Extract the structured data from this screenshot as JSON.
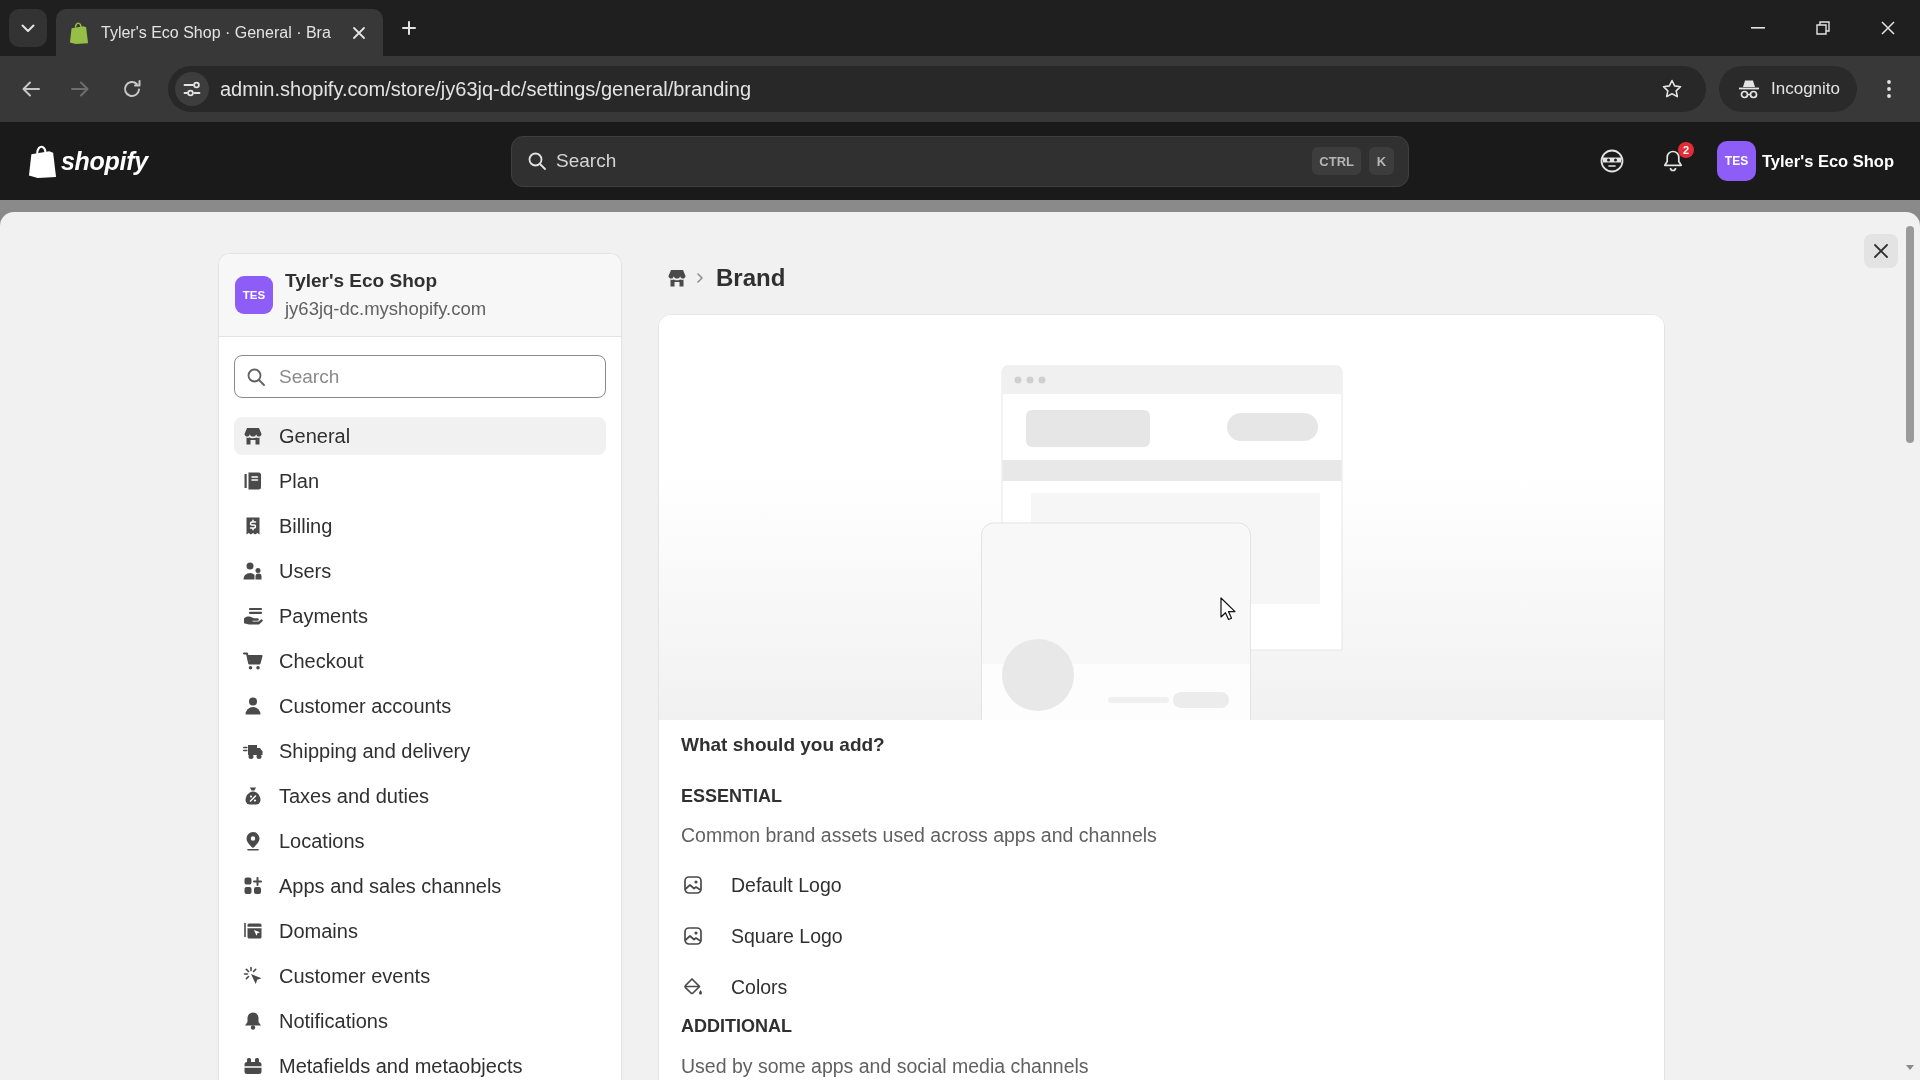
{
  "browser": {
    "tab": {
      "title": "Tyler's Eco Shop · General · Bra",
      "selected": true
    },
    "url": "admin.shopify.com/store/jy63jq-dc/settings/general/branding",
    "incognito_label": "Incognito"
  },
  "topbar": {
    "logo_text": "shopify",
    "search": {
      "placeholder": "Search",
      "shortcut_keys": [
        "CTRL",
        "K"
      ]
    },
    "notification_count": "2",
    "store": {
      "initials": "TES",
      "name": "Tyler's Eco Shop"
    }
  },
  "sidebar": {
    "store": {
      "initials": "TES",
      "name": "Tyler's Eco Shop",
      "domain": "jy63jq-dc.myshopify.com"
    },
    "search": {
      "placeholder": "Search"
    },
    "items": [
      {
        "label": "General",
        "selected": true
      },
      {
        "label": "Plan",
        "selected": false
      },
      {
        "label": "Billing",
        "selected": false
      },
      {
        "label": "Users",
        "selected": false
      },
      {
        "label": "Payments",
        "selected": false
      },
      {
        "label": "Checkout",
        "selected": false
      },
      {
        "label": "Customer accounts",
        "selected": false
      },
      {
        "label": "Shipping and delivery",
        "selected": false
      },
      {
        "label": "Taxes and duties",
        "selected": false
      },
      {
        "label": "Locations",
        "selected": false
      },
      {
        "label": "Apps and sales channels",
        "selected": false
      },
      {
        "label": "Domains",
        "selected": false
      },
      {
        "label": "Customer events",
        "selected": false
      },
      {
        "label": "Notifications",
        "selected": false
      },
      {
        "label": "Metafields and metaobjects",
        "selected": false
      }
    ]
  },
  "main": {
    "breadcrumb": {
      "title": "Brand"
    },
    "card": {
      "heading": "What should you add?",
      "sections": [
        {
          "title": "ESSENTIAL",
          "description": "Common brand assets used across apps and channels",
          "items": [
            "Default Logo",
            "Square Logo",
            "Colors"
          ]
        },
        {
          "title": "ADDITIONAL",
          "description": "Used by some apps and social media channels"
        }
      ]
    }
  }
}
